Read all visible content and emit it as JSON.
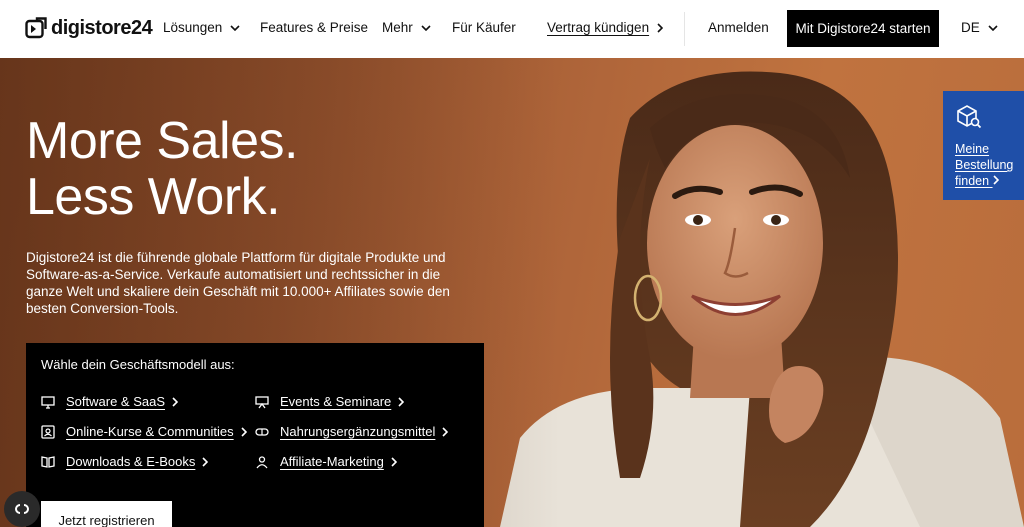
{
  "header": {
    "logo_text": "digistore24",
    "nav": {
      "solutions": "Lösungen",
      "features": "Features & Preise",
      "more": "Mehr",
      "buyers": "Für Käufer",
      "cancel_contract": "Vertrag kündigen",
      "login": "Anmelden",
      "start": "Mit Digistore24 starten",
      "language": "DE"
    }
  },
  "hero": {
    "headline_line1": "More Sales.",
    "headline_line2": "Less Work.",
    "intro": "Digistore24 ist die führende globale Plattform für digitale Produkte und Software-as-a-Service. Verkaufe automatisiert und rechtssicher in die ganze Welt und skaliere dein Geschäft mit 10.000+ Affiliates sowie den besten Conversion-Tools.",
    "model_box": {
      "title": "Wähle dein Geschäftsmodell aus:",
      "links": [
        {
          "label": "Software & SaaS",
          "icon": "monitor-icon"
        },
        {
          "label": "Events & Seminare",
          "icon": "presentation-icon"
        },
        {
          "label": "Online-Kurse & Communities",
          "icon": "course-icon"
        },
        {
          "label": "Nahrungsergänzungsmittel",
          "icon": "capsule-icon"
        },
        {
          "label": "Downloads & E-Books",
          "icon": "book-icon"
        },
        {
          "label": "Affiliate-Marketing",
          "icon": "users-icon"
        }
      ],
      "register": "Jetzt registrieren"
    },
    "order_box": {
      "line1": "Meine",
      "line2": "Bestellung",
      "line3": "finden"
    }
  },
  "colors": {
    "order_box": "#1f4fa8",
    "cta": "#000000",
    "hero_brown": "#b0663a"
  }
}
